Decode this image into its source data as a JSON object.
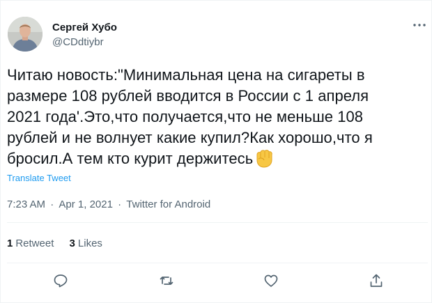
{
  "author": {
    "display_name": "Сергей Хубо",
    "handle": "@CDdtiybr",
    "avatar": "profile-photo"
  },
  "tweet": {
    "text": "Читаю новость:\"Минимальная цена на сигареты в\nразмере 108 рублей вводится в России с 1 апреля\n2021 года'.Это,что получается,что не меньше 108\nрублей и не волнует какие купил?Как хорошо,что я\nбросил.А тем кто курит держитесь",
    "emoji": "raised-fist-emoji",
    "translate_label": "Translate Tweet"
  },
  "meta": {
    "time": "7:23 AM",
    "separator": "·",
    "date": "Apr 1, 2021",
    "source": "Twitter for Android"
  },
  "stats": {
    "retweets_count": "1",
    "retweets_label": "Retweet",
    "likes_count": "3",
    "likes_label": "Likes"
  },
  "actions": [
    "reply-icon",
    "retweet-icon",
    "like-icon",
    "share-icon"
  ],
  "colors": {
    "link": "#1d9bf0",
    "secondary_text": "#536471",
    "primary_text": "#0f1419",
    "divider": "#eff3f4"
  }
}
